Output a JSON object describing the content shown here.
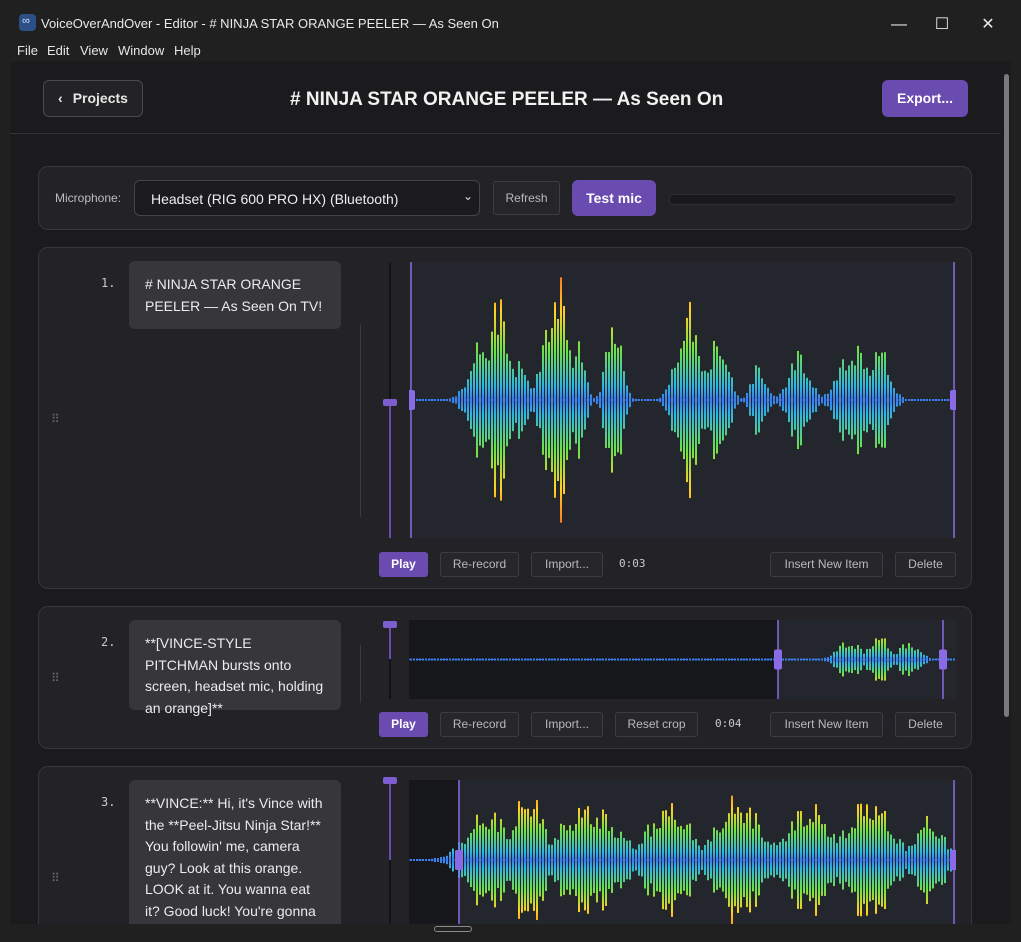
{
  "window": {
    "title": "VoiceOverAndOver - Editor - # NINJA STAR ORANGE PEELER — As Seen On",
    "controls": {
      "minimize": "—",
      "maximize": "☐",
      "close": "✕"
    }
  },
  "menu": [
    "File",
    "Edit",
    "View",
    "Window",
    "Help"
  ],
  "header": {
    "back_label": "Projects",
    "page_title": "# NINJA STAR ORANGE PEELER — As Seen On",
    "export_label": "Export..."
  },
  "mic": {
    "label": "Microphone:",
    "selected": "Headset (RIG 600 PRO HX) (Bluetooth)",
    "refresh_label": "Refresh",
    "test_label": "Test mic"
  },
  "items": [
    {
      "number": "1.",
      "text": "# NINJA STAR ORANGE PEELER — As Seen On TV!",
      "duration": "0:03",
      "volume": 0.52,
      "buttons": {
        "play": "Play",
        "rerecord": "Re-record",
        "import": "Import...",
        "insert": "Insert New Item",
        "delete": "Delete"
      }
    },
    {
      "number": "2.",
      "text": "**[VINCE-STYLE PITCHMAN bursts onto screen, headset mic, holding an orange]**",
      "duration": "0:04",
      "volume": 1.0,
      "buttons": {
        "play": "Play",
        "rerecord": "Re-record",
        "import": "Import...",
        "reset_crop": "Reset crop",
        "insert": "Insert New Item",
        "delete": "Delete"
      }
    },
    {
      "number": "3.",
      "text": "**VINCE:** Hi, it's Vince with the **Peel-Jitsu Ninja Star!** You followin' me, camera guy? Look at this orange. LOOK at it. You wanna eat it? Good luck! You're gonna",
      "volume": 1.0
    }
  ],
  "colors": {
    "accent": "#6a4bb0",
    "panel": "#232327",
    "background": "#1b1b1d"
  }
}
